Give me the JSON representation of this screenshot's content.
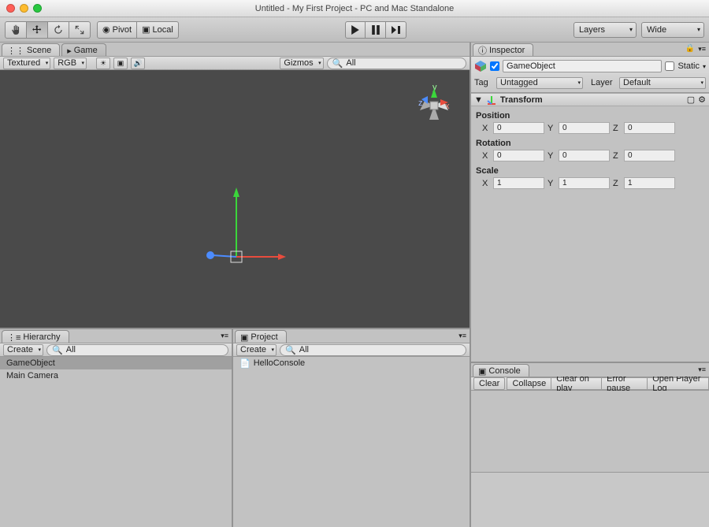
{
  "window": {
    "title": "Untitled - My First Project - PC and Mac Standalone"
  },
  "toolbar": {
    "pivot_label": "Pivot",
    "local_label": "Local",
    "layers_label": "Layers",
    "layout_label": "Wide"
  },
  "scene": {
    "tab_scene": "Scene",
    "tab_game": "Game",
    "shading": "Textured",
    "render_mode": "RGB",
    "gizmos_label": "Gizmos",
    "search_placeholder": "All",
    "axis": {
      "x": "x",
      "y": "y",
      "z": "z"
    }
  },
  "hierarchy": {
    "tab": "Hierarchy",
    "create_label": "Create",
    "search_placeholder": "All",
    "items": [
      {
        "name": "GameObject",
        "selected": true
      },
      {
        "name": "Main Camera",
        "selected": false
      }
    ]
  },
  "project": {
    "tab": "Project",
    "create_label": "Create",
    "search_placeholder": "All",
    "items": [
      {
        "name": "HelloConsole"
      }
    ]
  },
  "inspector": {
    "tab": "Inspector",
    "object_name": "GameObject",
    "static_label": "Static",
    "tag_label": "Tag",
    "tag_value": "Untagged",
    "layer_label": "Layer",
    "layer_value": "Default",
    "transform": {
      "title": "Transform",
      "position_label": "Position",
      "rotation_label": "Rotation",
      "scale_label": "Scale",
      "position": {
        "x": "0",
        "y": "0",
        "z": "0"
      },
      "rotation": {
        "x": "0",
        "y": "0",
        "z": "0"
      },
      "scale": {
        "x": "1",
        "y": "1",
        "z": "1"
      }
    }
  },
  "console": {
    "tab": "Console",
    "clear": "Clear",
    "collapse": "Collapse",
    "clear_on_play": "Clear on play",
    "error_pause": "Error pause",
    "open_player_log": "Open Player Log"
  }
}
